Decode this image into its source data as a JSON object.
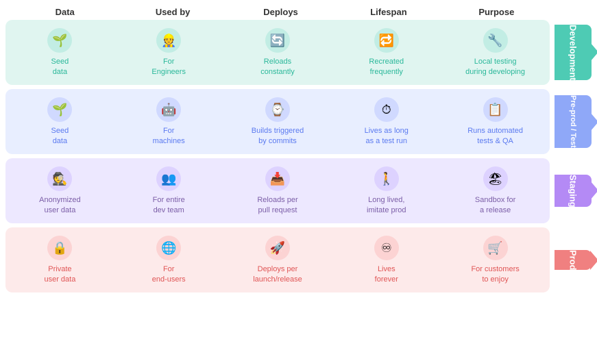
{
  "headers": {
    "col1": "Data",
    "col2": "Used by",
    "col3": "Deploys",
    "col4": "Lifespan",
    "col5": "Purpose"
  },
  "rows": [
    {
      "id": "dev",
      "label": "Development",
      "cells": [
        {
          "icon": "🌱",
          "text": "Seed\ndata"
        },
        {
          "icon": "👷",
          "text": "For\nEngineers"
        },
        {
          "icon": "🔄",
          "text": "Reloads\nconstantly"
        },
        {
          "icon": "🔁",
          "text": "Recreated\nfrequently"
        },
        {
          "icon": "🔧",
          "text": "Local testing\nduring developing"
        }
      ]
    },
    {
      "id": "test",
      "label": "Pre-prod",
      "sublabel": "Test",
      "cells": [
        {
          "icon": "🌱",
          "text": "Seed\ndata"
        },
        {
          "icon": "🤖",
          "text": "For\nmachines"
        },
        {
          "icon": "⌚",
          "text": "Builds triggered\nby commits"
        },
        {
          "icon": "⏱",
          "text": "Lives as long\nas a test run"
        },
        {
          "icon": "📋",
          "text": "Runs automated\ntests & QA"
        }
      ]
    },
    {
      "id": "staging",
      "label": "Staging",
      "cells": [
        {
          "icon": "🕵",
          "text": "Anonymized\nuser data"
        },
        {
          "icon": "👥",
          "text": "For entire\ndev team"
        },
        {
          "icon": "📥",
          "text": "Reloads per\npull request"
        },
        {
          "icon": "🚶",
          "text": "Long lived,\nimitate prod"
        },
        {
          "icon": "🏖",
          "text": "Sandbox for\na release"
        }
      ]
    },
    {
      "id": "prod",
      "label": "Prod",
      "cells": [
        {
          "icon": "🔒",
          "text": "Private\nuser data"
        },
        {
          "icon": "🌐",
          "text": "For\nend-users"
        },
        {
          "icon": "🚀",
          "text": "Deploys per\nlaunch/release"
        },
        {
          "icon": "♾",
          "text": "Lives\nforever"
        },
        {
          "icon": "🛒",
          "text": "For customers\nto enjoy"
        }
      ]
    }
  ]
}
